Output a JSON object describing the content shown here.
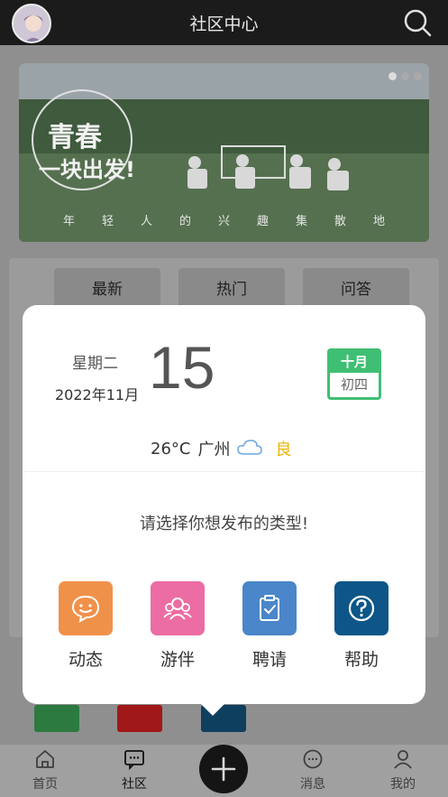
{
  "header": {
    "title": "社区中心"
  },
  "banner": {
    "headline_line1": "青春",
    "headline_line2": "一块出发!",
    "tagline": "年轻人的兴趣集散地",
    "carousel_total": 3,
    "carousel_active": 1
  },
  "tabs": [
    "最新",
    "热门",
    "问答"
  ],
  "modal": {
    "weekday": "星期二",
    "year_month": "2022年11月",
    "day": "15",
    "lunar_month": "十月",
    "lunar_day": "初四",
    "temperature": "26°C",
    "city": "广州",
    "weather_icon": "cloud-icon",
    "air_quality": "良",
    "prompt": "请选择你想发布的类型!",
    "actions": [
      {
        "label": "动态",
        "icon": "smile-bubble-icon",
        "color": "#f0914a"
      },
      {
        "label": "游伴",
        "icon": "group-icon",
        "color": "#ec6da3"
      },
      {
        "label": "聘请",
        "icon": "clipboard-check-icon",
        "color": "#4a86c9"
      },
      {
        "label": "帮助",
        "icon": "question-icon",
        "color": "#0d5687"
      }
    ]
  },
  "bottom_nav": [
    {
      "label": "首页",
      "icon": "home-icon"
    },
    {
      "label": "社区",
      "icon": "chat-icon"
    },
    {
      "label": "消息",
      "icon": "message-icon"
    },
    {
      "label": "我的",
      "icon": "user-icon"
    }
  ],
  "colors": {
    "accent_green": "#3fbf73",
    "air_quality": "#e9b400",
    "topbar": "#1b1b1b"
  }
}
